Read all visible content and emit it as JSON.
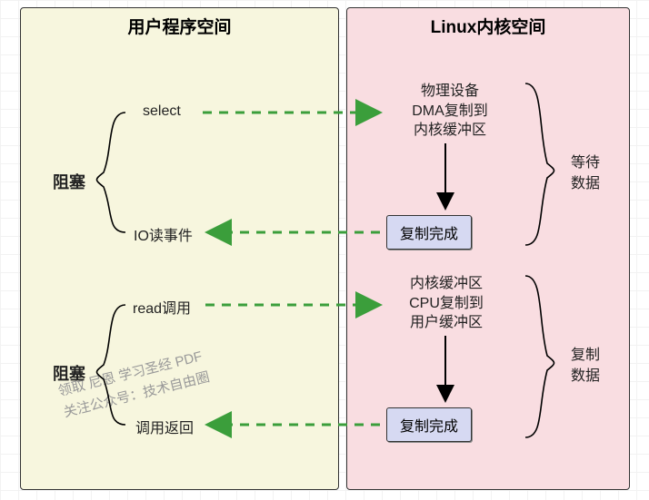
{
  "diagram": {
    "user_title": "用户程序空间",
    "kernel_title": "Linux内核空间",
    "blocking_label_1": "阻塞",
    "blocking_label_2": "阻塞",
    "select_label": "select",
    "io_event_label": "IO读事件",
    "read_call_label": "read调用",
    "call_return_label": "调用返回",
    "kernel_step1_line1": "物理设备",
    "kernel_step1_line2": "DMA复制到",
    "kernel_step1_line3": "内核缓冲区",
    "kernel_step2_box": "复制完成",
    "kernel_step3_line1": "内核缓冲区",
    "kernel_step3_line2": "CPU复制到",
    "kernel_step3_line3": "用户缓冲区",
    "kernel_step4_box": "复制完成",
    "right_label_1a": "等待",
    "right_label_1b": "数据",
    "right_label_2a": "复制",
    "right_label_2b": "数据",
    "watermark_line1": "领取 尼恩 学习圣经 PDF",
    "watermark_line2": "关注公众号：技术自由圈"
  }
}
